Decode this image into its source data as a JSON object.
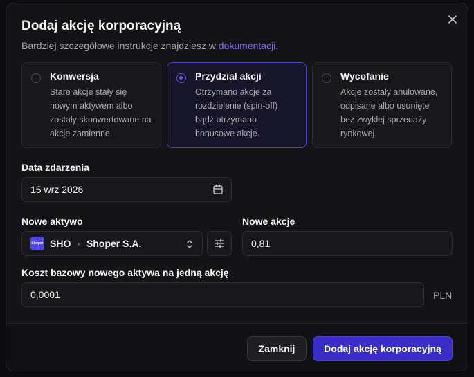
{
  "dialog": {
    "title": "Dodaj akcję korporacyjną",
    "subtitle_prefix": "Bardziej szczegółowe instrukcje znajdziesz w ",
    "subtitle_link": "dokumentacji",
    "subtitle_suffix": "."
  },
  "action_types": [
    {
      "title": "Konwersja",
      "description": "Stare akcje stały się nowym aktywem albo zostały skonwertowane na akcje zamienne.",
      "selected": false
    },
    {
      "title": "Przydział akcji",
      "description": "Otrzymano akcje za rozdzielenie (spin-off) bądź otrzymano bonusowe akcje.",
      "selected": true
    },
    {
      "title": "Wycofanie",
      "description": "Akcje zostały anulowane, odpisane albo usunięte bez zwykłej sprzedaży rynkowej.",
      "selected": false
    }
  ],
  "event_date": {
    "label": "Data zdarzenia",
    "value": "15 wrz 2026"
  },
  "new_asset": {
    "label": "Nowe aktywo",
    "ticker": "SHO",
    "separator": "·",
    "name": "Shoper S.A.",
    "logo_text": "Shoper"
  },
  "new_shares": {
    "label": "Nowe akcje",
    "value": "0,81"
  },
  "cost_basis": {
    "label": "Koszt bazowy nowego aktywa na jedną akcję",
    "value": "0,0001",
    "currency": "PLN"
  },
  "buttons": {
    "close": "Zamknij",
    "submit": "Dodaj akcję korporacyjną"
  },
  "colors": {
    "accent": "#3a2ec9",
    "link": "#7c6cf2",
    "background": "#141416"
  }
}
